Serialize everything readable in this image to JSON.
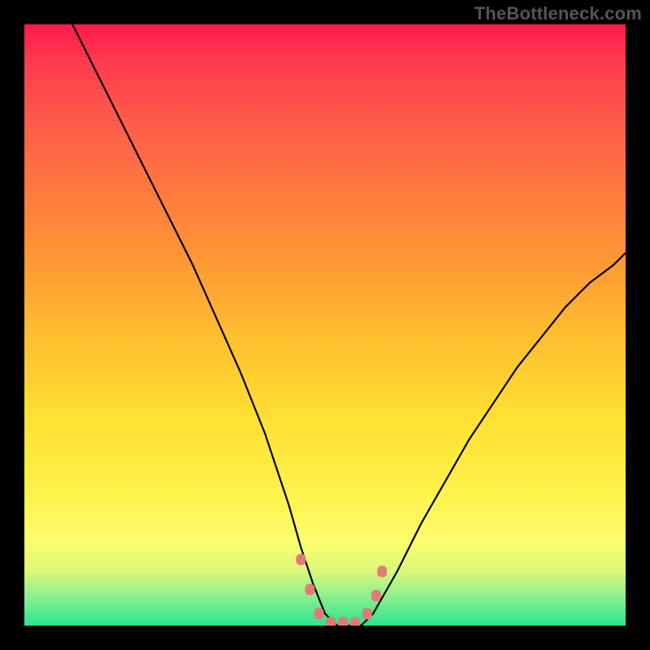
{
  "credit": "TheBottleneck.com",
  "chart_data": {
    "type": "line",
    "title": "",
    "xlabel": "",
    "ylabel": "",
    "xlim": [
      0,
      100
    ],
    "ylim": [
      0,
      100
    ],
    "series": [
      {
        "name": "curve",
        "x": [
          8,
          12,
          16,
          20,
          24,
          28,
          32,
          36,
          40,
          44,
          46,
          48,
          50,
          52,
          54,
          56,
          58,
          62,
          66,
          70,
          74,
          78,
          82,
          86,
          90,
          94,
          98,
          100
        ],
        "y": [
          100,
          92,
          84,
          76,
          68,
          60,
          51,
          42,
          32,
          20,
          13,
          7,
          2,
          0,
          0,
          0,
          2,
          9,
          17,
          24,
          31,
          37,
          43,
          48,
          53,
          57,
          60,
          62
        ]
      }
    ],
    "markers": {
      "comment": "pink rectangular beads along the flat valley",
      "color": "#e37a7a",
      "points": [
        {
          "x": 46,
          "y": 11
        },
        {
          "x": 47.5,
          "y": 6
        },
        {
          "x": 49,
          "y": 2
        },
        {
          "x": 51,
          "y": 0.5
        },
        {
          "x": 53,
          "y": 0.5
        },
        {
          "x": 55,
          "y": 0.5
        },
        {
          "x": 57,
          "y": 2
        },
        {
          "x": 58.5,
          "y": 5
        },
        {
          "x": 59.5,
          "y": 9
        }
      ]
    },
    "gradient_stops": [
      {
        "pos": 0,
        "color": "#ff1a4a"
      },
      {
        "pos": 50,
        "color": "#ffbf2e"
      },
      {
        "pos": 80,
        "color": "#fff24a"
      },
      {
        "pos": 100,
        "color": "#29e58f"
      }
    ]
  }
}
